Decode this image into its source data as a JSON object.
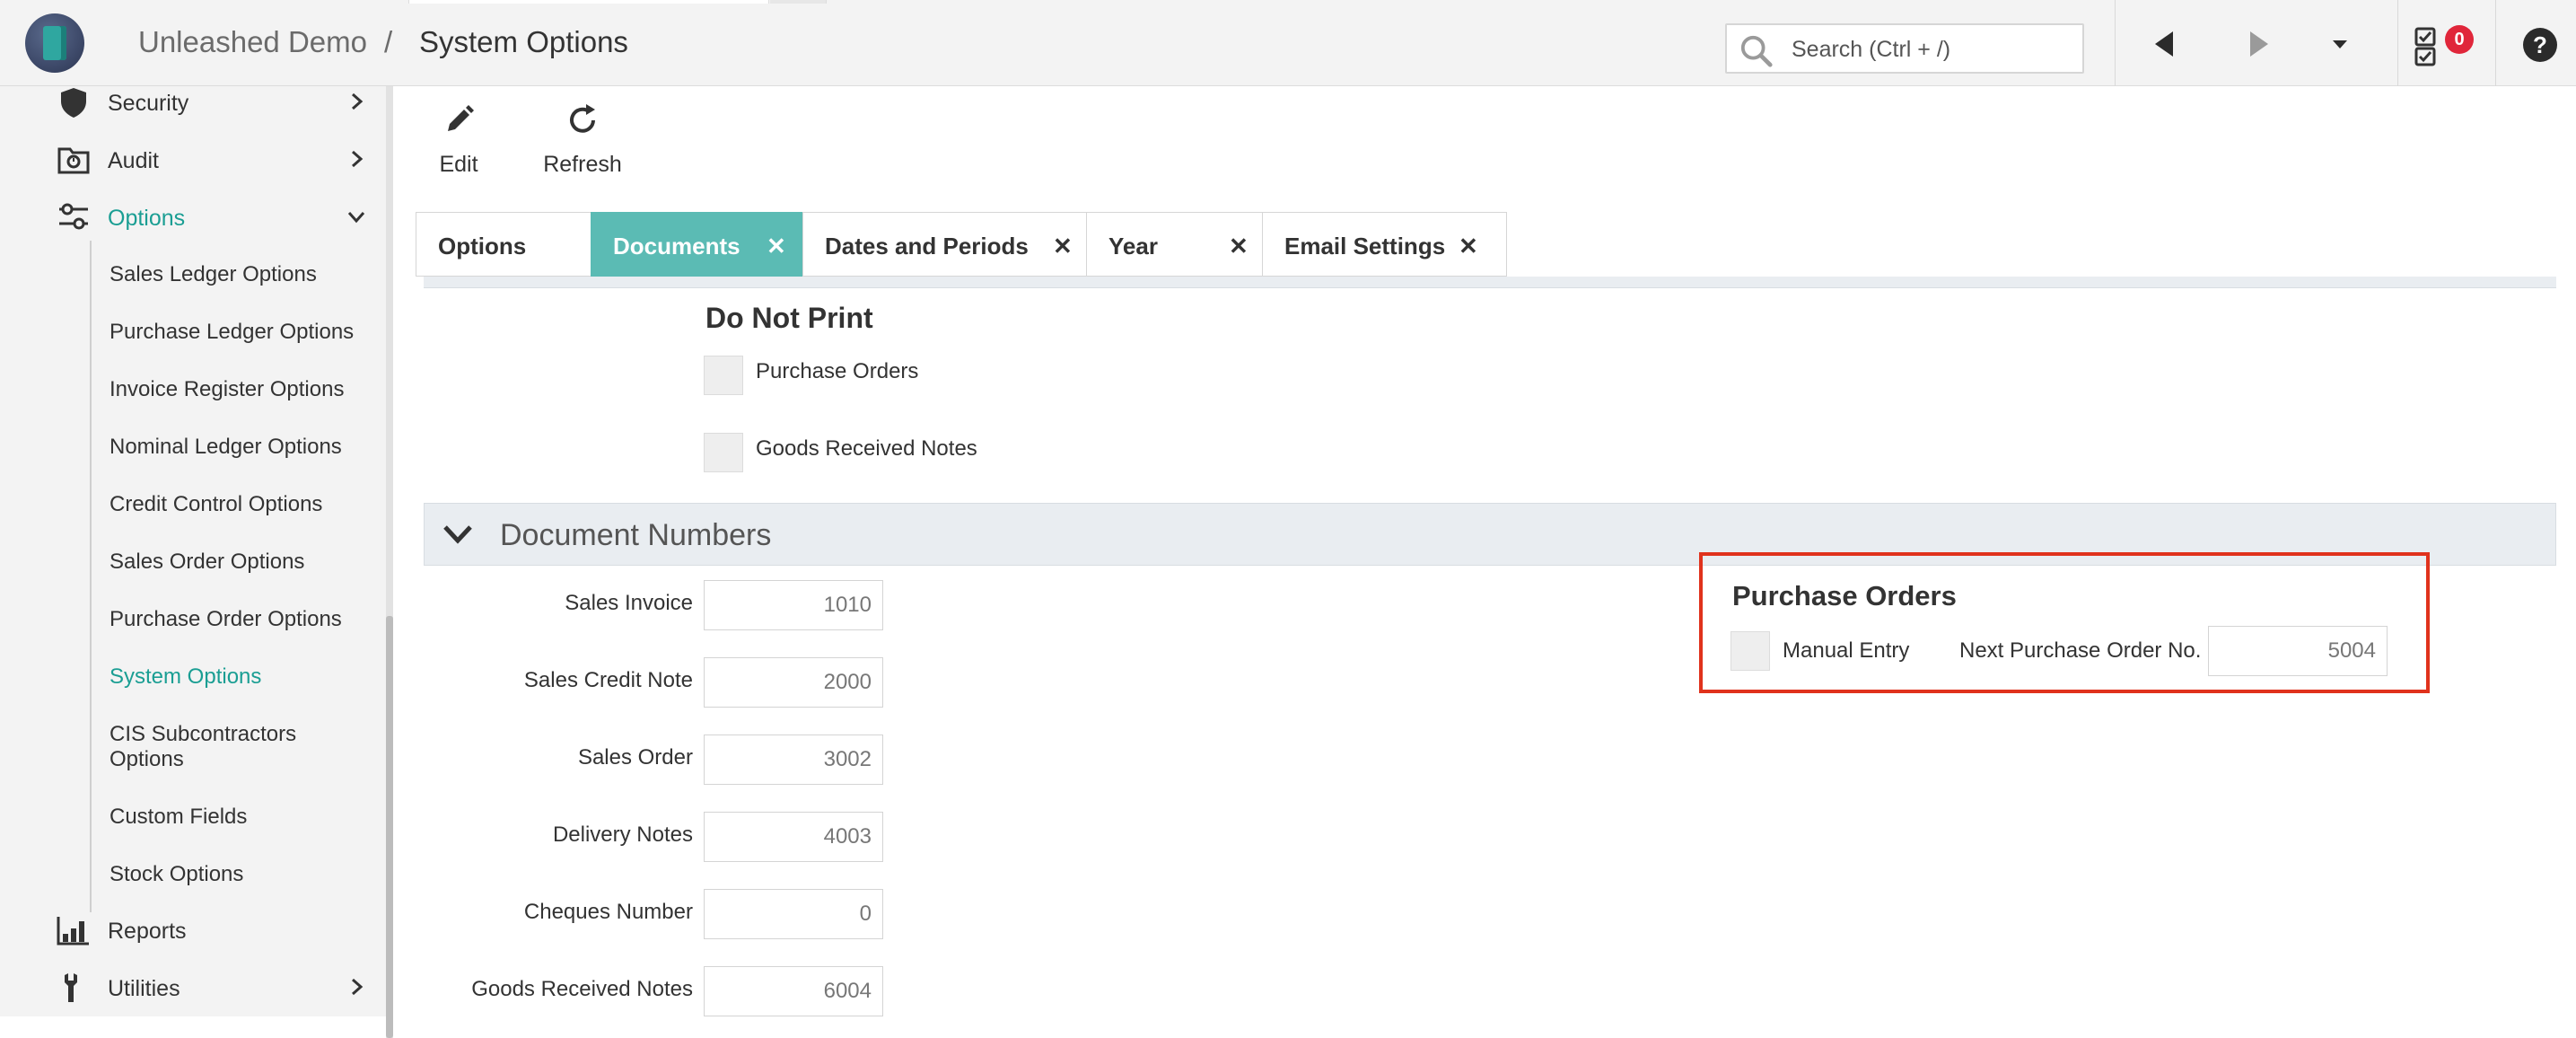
{
  "header": {
    "breadcrumb_app": "Unleashed Demo",
    "breadcrumb_sep": "/",
    "page_title": "System Options",
    "search_placeholder": "Search (Ctrl + /)",
    "tasks_badge": "0"
  },
  "sidebar": {
    "items": [
      {
        "label": "Security",
        "icon": "shield-icon"
      },
      {
        "label": "Audit",
        "icon": "audit-icon"
      },
      {
        "label": "Options",
        "icon": "sliders-icon"
      },
      {
        "label": "Reports",
        "icon": "bar-chart-icon"
      },
      {
        "label": "Utilities",
        "icon": "wrench-icon"
      }
    ],
    "subitems": [
      "Sales Ledger Options",
      "Purchase Ledger Options",
      "Invoice Register Options",
      "Nominal Ledger Options",
      "Credit Control Options",
      "Sales Order Options",
      "Purchase Order Options",
      "System Options",
      "CIS Subcontractors Options",
      "Custom Fields",
      "Stock Options"
    ],
    "active_subitem": "System Options"
  },
  "toolbar": {
    "edit_label": "Edit",
    "refresh_label": "Refresh"
  },
  "tabs": [
    {
      "label": "Options",
      "closable": false
    },
    {
      "label": "Documents",
      "closable": true,
      "active": true
    },
    {
      "label": "Dates and Periods",
      "closable": true
    },
    {
      "label": "Year",
      "closable": true
    },
    {
      "label": "Email Settings",
      "closable": true
    }
  ],
  "tab_close_glyph": "✕",
  "do_not_print": {
    "title": "Do Not Print",
    "options": [
      "Purchase Orders",
      "Goods Received Notes"
    ]
  },
  "document_numbers": {
    "title": "Document Numbers",
    "fields": [
      {
        "label": "Sales Invoice",
        "value": "1010"
      },
      {
        "label": "Sales Credit Note",
        "value": "2000"
      },
      {
        "label": "Sales Order",
        "value": "3002"
      },
      {
        "label": "Delivery Notes",
        "value": "4003"
      },
      {
        "label": "Cheques Number",
        "value": "0"
      },
      {
        "label": "Goods Received Notes",
        "value": "6004"
      }
    ]
  },
  "purchase_orders": {
    "title": "Purchase Orders",
    "manual_entry_label": "Manual Entry",
    "next_no_label": "Next Purchase Order No.",
    "next_no_value": "5004"
  },
  "colors": {
    "accent": "#1a9e93",
    "active_tab": "#5bbbb4",
    "badge": "#e0263a",
    "highlight": "#e0321c"
  }
}
